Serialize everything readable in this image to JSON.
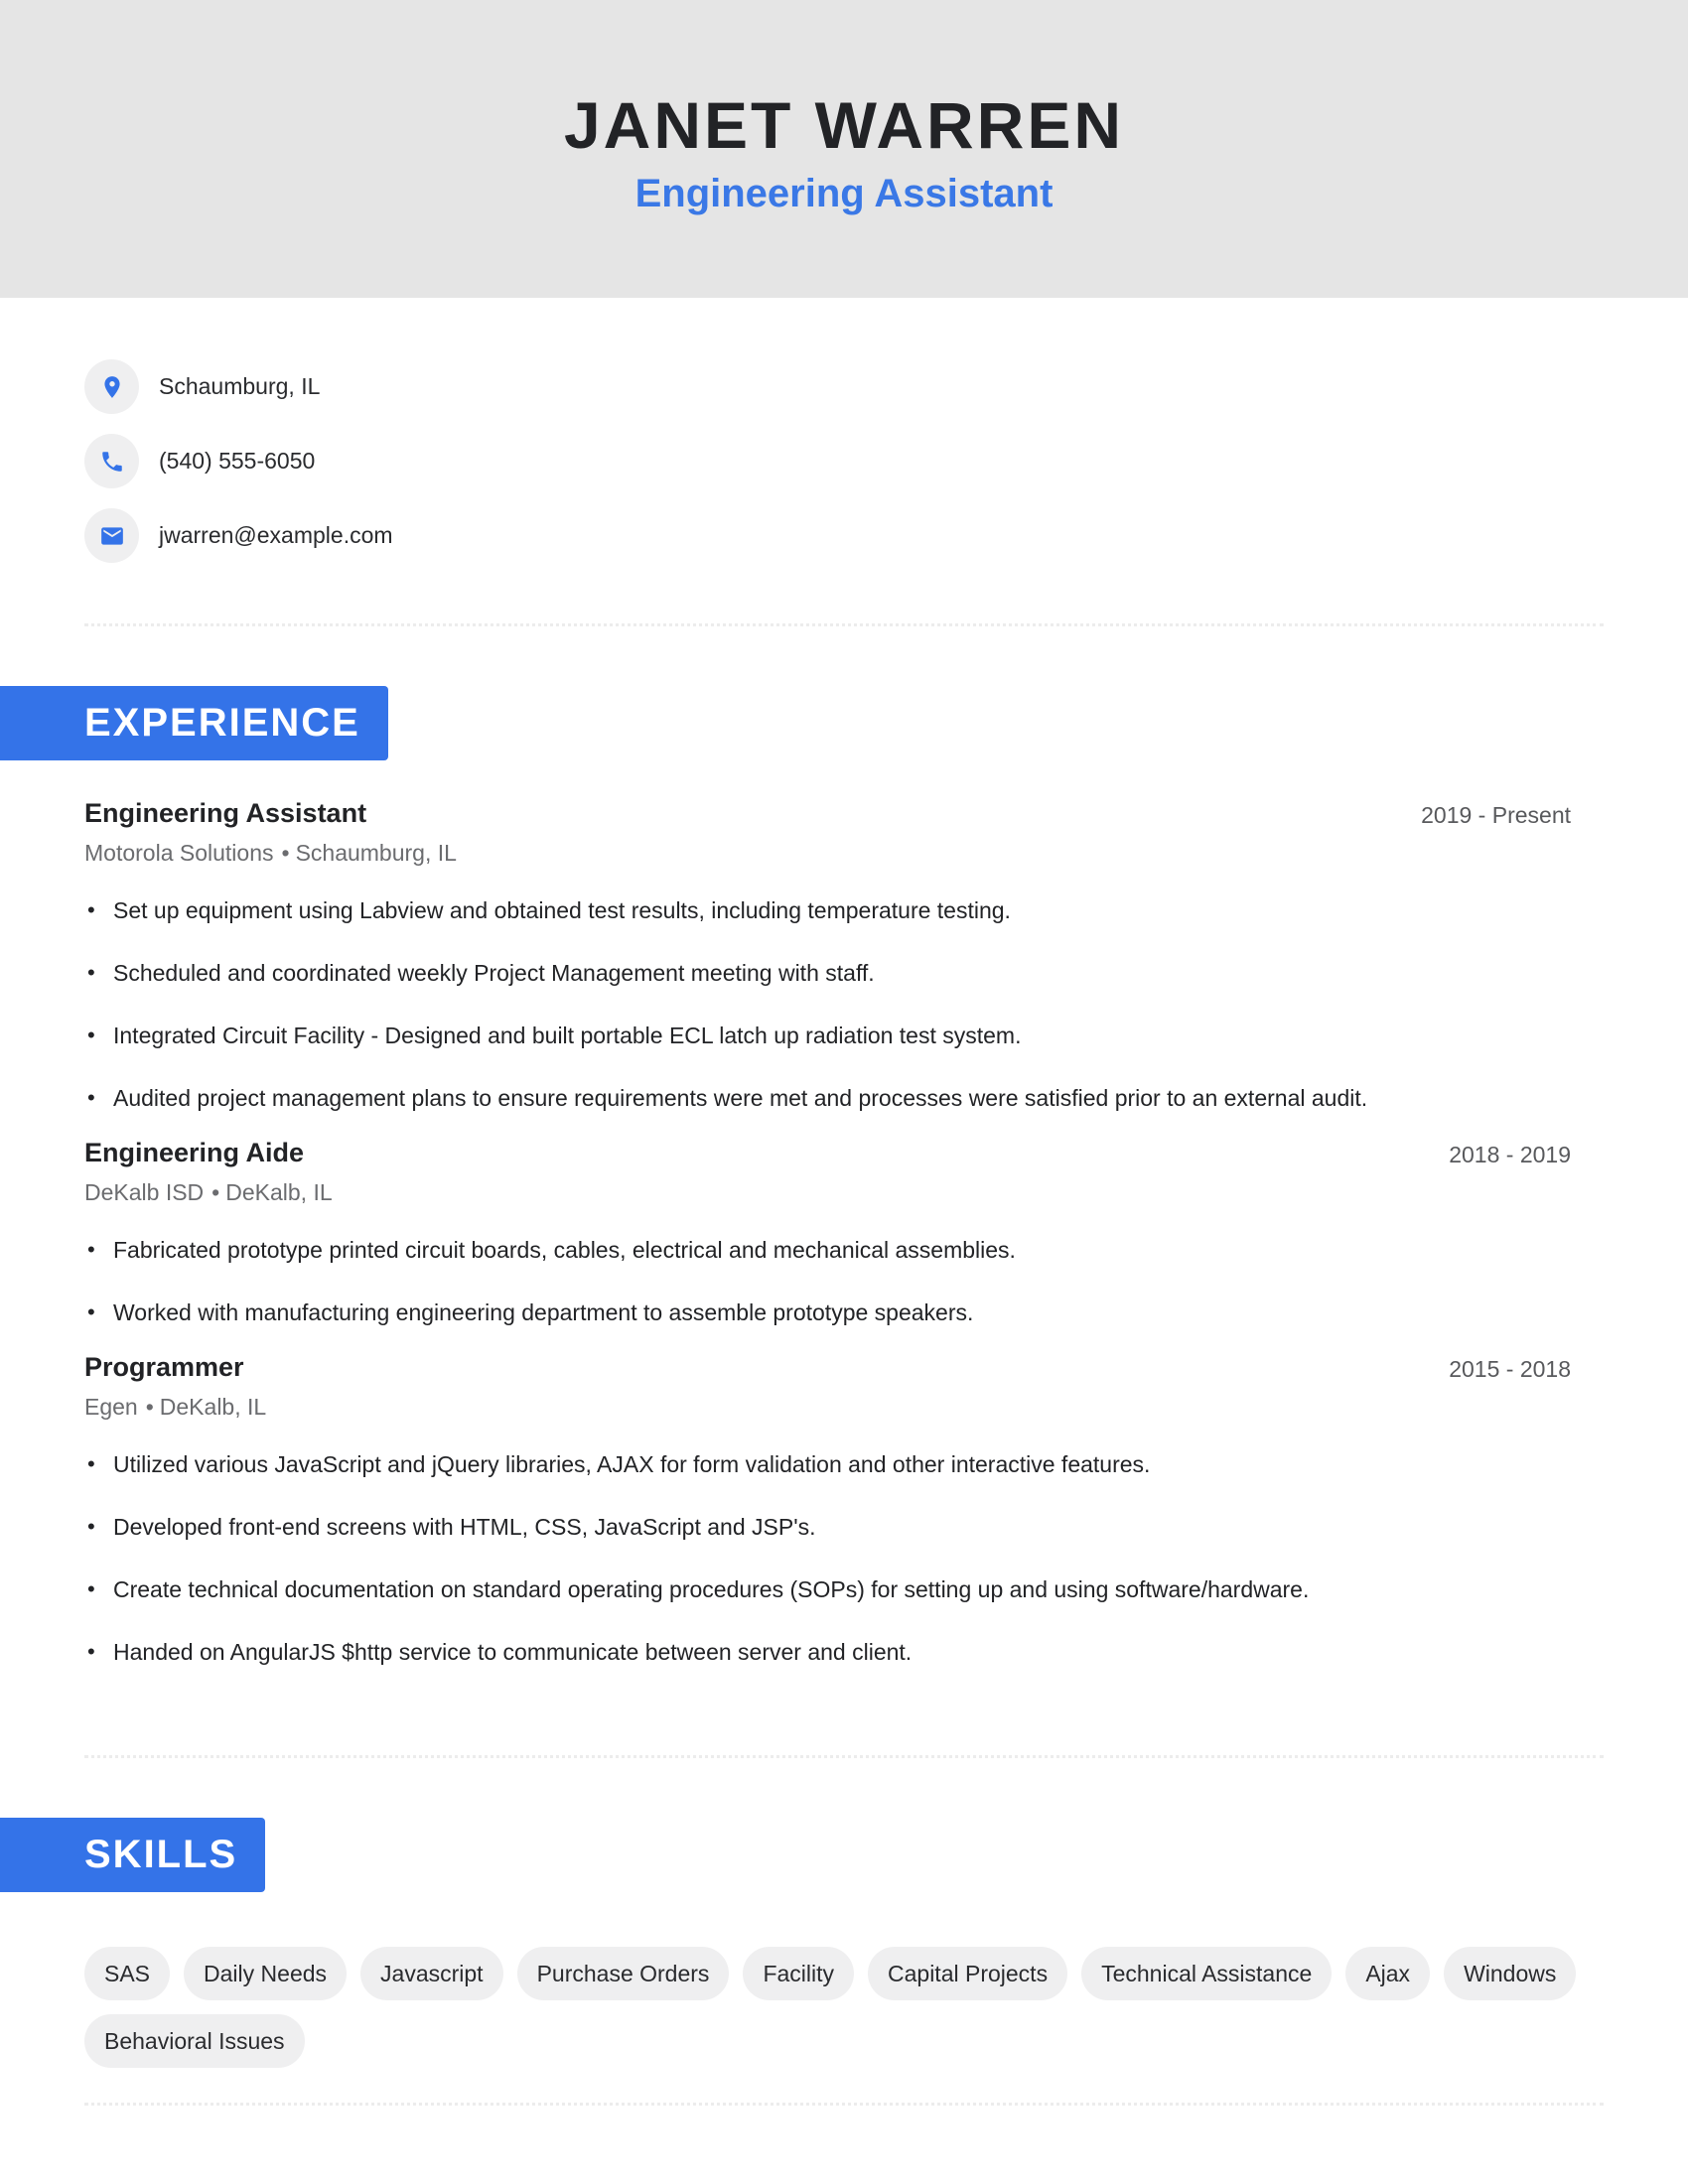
{
  "header": {
    "name": "JANET WARREN",
    "title": "Engineering Assistant"
  },
  "contact": [
    {
      "icon": "location-pin-icon",
      "text": "Schaumburg, IL"
    },
    {
      "icon": "phone-icon",
      "text": "(540) 555-6050"
    },
    {
      "icon": "email-icon",
      "text": "jwarren@example.com"
    }
  ],
  "colors": {
    "accent": "#3473e8",
    "header_bg": "#e5e5e5",
    "chip_bg": "#efeff0"
  },
  "experience": {
    "heading": "EXPERIENCE",
    "jobs": [
      {
        "title": "Engineering Assistant",
        "dates": "2019 - Present",
        "company": "Motorola Solutions",
        "location": "Schaumburg, IL",
        "bullets": [
          "Set up equipment using Labview and obtained test results, including temperature testing.",
          "Scheduled and coordinated weekly Project Management meeting with staff.",
          "Integrated Circuit Facility - Designed and built portable ECL latch up radiation test system.",
          "Audited project management plans to ensure requirements were met and processes were satisfied prior to an external audit."
        ]
      },
      {
        "title": "Engineering Aide",
        "dates": "2018 - 2019",
        "company": "DeKalb ISD",
        "location": "DeKalb, IL",
        "bullets": [
          "Fabricated prototype printed circuit boards, cables, electrical and mechanical assemblies.",
          "Worked with manufacturing engineering department to assemble prototype speakers."
        ]
      },
      {
        "title": "Programmer",
        "dates": "2015 - 2018",
        "company": "Egen",
        "location": "DeKalb, IL",
        "bullets": [
          "Utilized various JavaScript and jQuery libraries, AJAX for form validation and other interactive features.",
          "Developed front-end screens with HTML, CSS, JavaScript and JSP's.",
          "Create technical documentation on standard operating procedures (SOPs) for setting up and using software/hardware.",
          "Handed on AngularJS $http service to communicate between server and client."
        ]
      }
    ]
  },
  "skills": {
    "heading": "SKILLS",
    "items": [
      "SAS",
      "Daily Needs",
      "Javascript",
      "Purchase Orders",
      "Facility",
      "Capital Projects",
      "Technical Assistance",
      "Ajax",
      "Windows",
      "Behavioral Issues"
    ]
  },
  "separator": "•"
}
